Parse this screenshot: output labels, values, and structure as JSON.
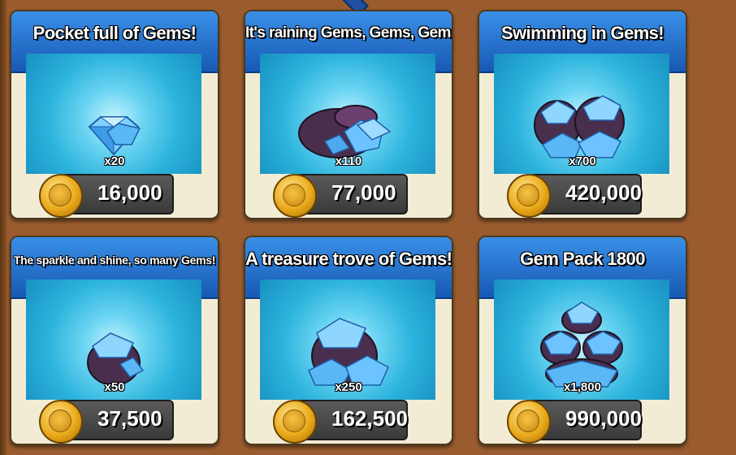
{
  "shop": {
    "packs": [
      {
        "title": "Pocket full of Gems!",
        "quantity": "x20",
        "price": "16,000",
        "currency_icon": "gold-coin-icon",
        "art": "single-gem-icon"
      },
      {
        "title": "It's raining Gems, Gems, Gems!",
        "quantity": "x110",
        "price": "77,000",
        "currency_icon": "gold-coin-icon",
        "art": "gem-sack-icon"
      },
      {
        "title": "Swimming in Gems!",
        "quantity": "x700",
        "price": "420,000",
        "currency_icon": "gold-coin-icon",
        "art": "gem-sacks-pile-icon"
      },
      {
        "title": "The sparkle and shine, so many Gems!",
        "quantity": "x50",
        "price": "37,500",
        "currency_icon": "gold-coin-icon",
        "art": "gem-pouch-icon"
      },
      {
        "title": "A treasure trove of Gems!",
        "quantity": "x250",
        "price": "162,500",
        "currency_icon": "gold-coin-icon",
        "art": "gem-sack-large-icon"
      },
      {
        "title": "Gem Pack 1800",
        "quantity": "x1,800",
        "price": "990,000",
        "currency_icon": "gold-coin-icon",
        "art": "gem-sacks-mountain-icon"
      }
    ]
  },
  "colors": {
    "background": "#9a5c2e",
    "header_blue": "#1759b5",
    "card_cream": "#f2ecd4",
    "art_cyan": "#2bb3dc",
    "price_box": "#3a3a3a",
    "coin_gold": "#e9a91a"
  }
}
